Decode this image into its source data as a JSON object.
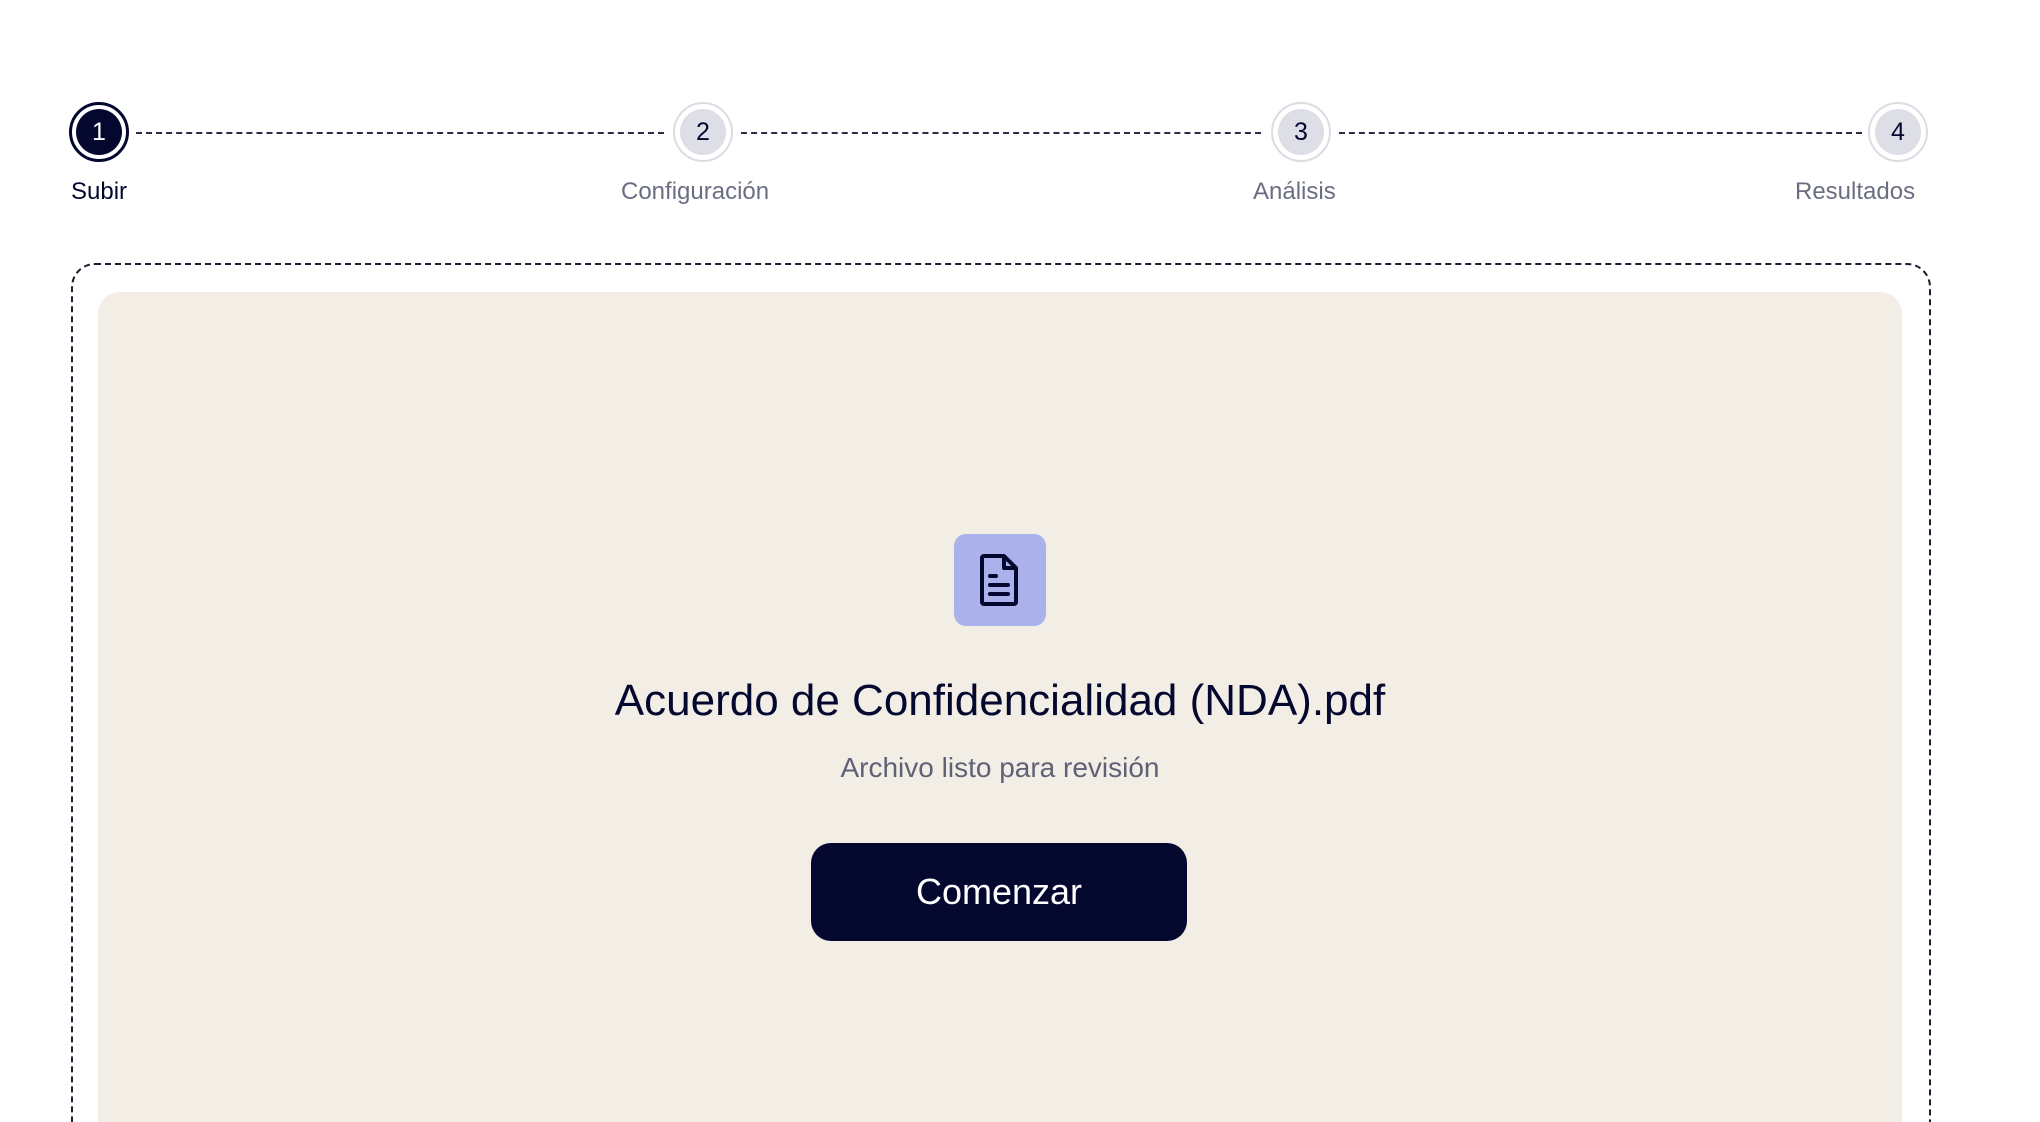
{
  "stepper": {
    "steps": [
      {
        "number": "1",
        "label": "Subir",
        "state": "active"
      },
      {
        "number": "2",
        "label": "Configuración",
        "state": "pending"
      },
      {
        "number": "3",
        "label": "Análisis",
        "state": "pending"
      },
      {
        "number": "4",
        "label": "Resultados",
        "state": "pending"
      }
    ]
  },
  "upload": {
    "icon": "document-icon",
    "file_name": "Acuerdo de Confidencialidad (NDA).pdf",
    "status": "Archivo listo para revisión",
    "start_label": "Comenzar"
  },
  "colors": {
    "primary": "#04072e",
    "icon_bg": "#aab1eb",
    "zone_bg": "#f2ede5",
    "muted_text": "#6b6e82",
    "pending_step_bg": "#dddee6"
  }
}
